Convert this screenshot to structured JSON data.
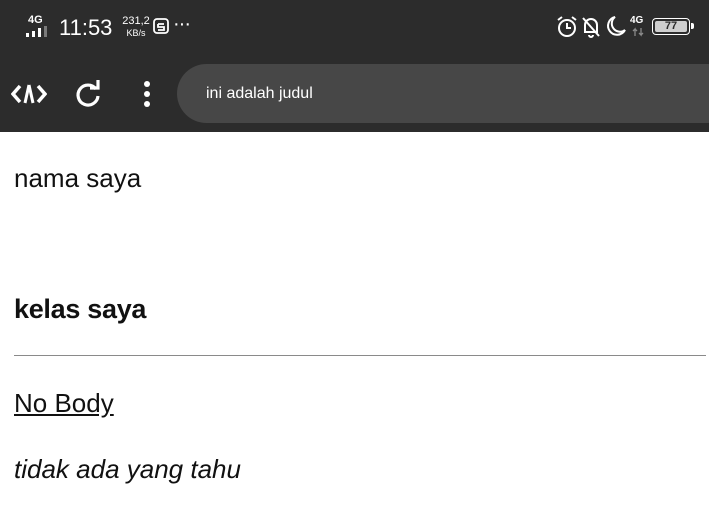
{
  "status_bar": {
    "network_type": "4G",
    "time": "11:53",
    "speed_value": "231,2",
    "speed_unit": "KB/s",
    "more": "···",
    "network_type_2": "4G",
    "battery": "77",
    "icons": [
      "signal-icon",
      "snapchat-icon",
      "alarm-icon",
      "bell-off-icon",
      "moon-icon",
      "battery-icon"
    ]
  },
  "toolbar": {
    "url": "ini adalah judul",
    "icons": [
      "code-icon",
      "reload-icon",
      "more-vertical-icon"
    ]
  },
  "page": {
    "paragraph": "nama saya",
    "heading": "kelas saya",
    "underlined": "No Body",
    "italic": "tidak ada yang tahu"
  },
  "colors": {
    "status_bg": "#2c2c2c",
    "urlbar_bg": "#474747",
    "page_bg": "#ffffff",
    "divider": "#8a8a8a"
  }
}
